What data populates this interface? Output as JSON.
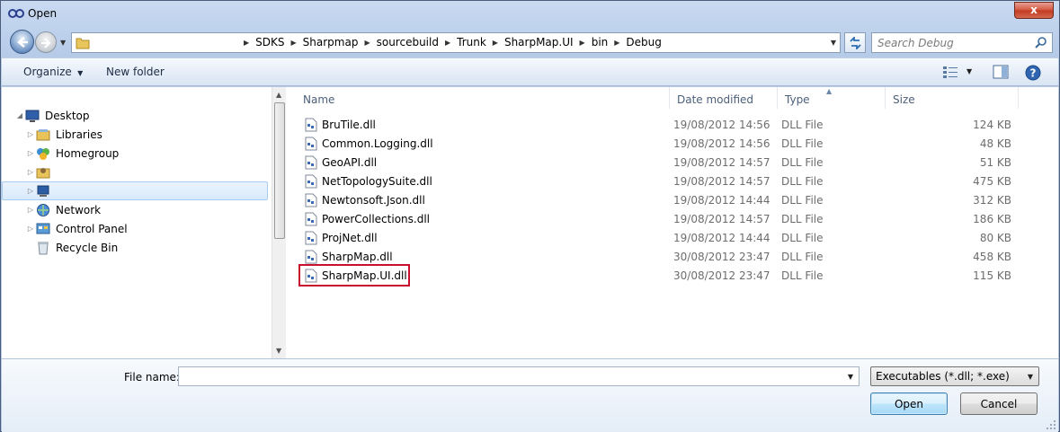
{
  "window": {
    "title": "Open",
    "close_label": "x"
  },
  "address": {
    "crumbs": [
      "SDKS",
      "Sharpmap",
      "sourcebuild",
      "Trunk",
      "SharpMap.UI",
      "bin",
      "Debug"
    ]
  },
  "search": {
    "placeholder": "Search Debug"
  },
  "toolbar": {
    "organize_label": "Organize",
    "new_folder_label": "New folder"
  },
  "nav": {
    "items": [
      {
        "label": "Desktop",
        "icon": "desktop-icon"
      },
      {
        "label": "Libraries",
        "icon": "libraries-icon"
      },
      {
        "label": "Homegroup",
        "icon": "homegroup-icon"
      },
      {
        "label": "",
        "icon": "user-folder-icon"
      },
      {
        "label": "",
        "icon": "computer-icon"
      },
      {
        "label": "Network",
        "icon": "network-icon"
      },
      {
        "label": "Control Panel",
        "icon": "control-panel-icon"
      },
      {
        "label": "Recycle Bin",
        "icon": "recycle-bin-icon"
      }
    ]
  },
  "columns": {
    "name": "Name",
    "date": "Date modified",
    "type": "Type",
    "size": "Size"
  },
  "files": [
    {
      "name": "BruTile.dll",
      "date": "19/08/2012 14:56",
      "type": "DLL File",
      "size": "124 KB"
    },
    {
      "name": "Common.Logging.dll",
      "date": "19/08/2012 14:56",
      "type": "DLL File",
      "size": "48 KB"
    },
    {
      "name": "GeoAPI.dll",
      "date": "19/08/2012 14:57",
      "type": "DLL File",
      "size": "51 KB"
    },
    {
      "name": "NetTopologySuite.dll",
      "date": "19/08/2012 14:57",
      "type": "DLL File",
      "size": "475 KB"
    },
    {
      "name": "Newtonsoft.Json.dll",
      "date": "19/08/2012 14:44",
      "type": "DLL File",
      "size": "312 KB"
    },
    {
      "name": "PowerCollections.dll",
      "date": "19/08/2012 14:57",
      "type": "DLL File",
      "size": "186 KB"
    },
    {
      "name": "ProjNet.dll",
      "date": "19/08/2012 14:44",
      "type": "DLL File",
      "size": "80 KB"
    },
    {
      "name": "SharpMap.dll",
      "date": "30/08/2012 23:47",
      "type": "DLL File",
      "size": "458 KB"
    },
    {
      "name": "SharpMap.UI.dll",
      "date": "30/08/2012 23:47",
      "type": "DLL File",
      "size": "115 KB"
    }
  ],
  "footer": {
    "file_name_label": "File name:",
    "file_name_value": "",
    "filter_label": "Executables (*.dll; *.exe)",
    "open_label": "Open",
    "cancel_label": "Cancel"
  },
  "colors": {
    "highlight_box": "#c8102e",
    "selection": "#d9eafc"
  }
}
